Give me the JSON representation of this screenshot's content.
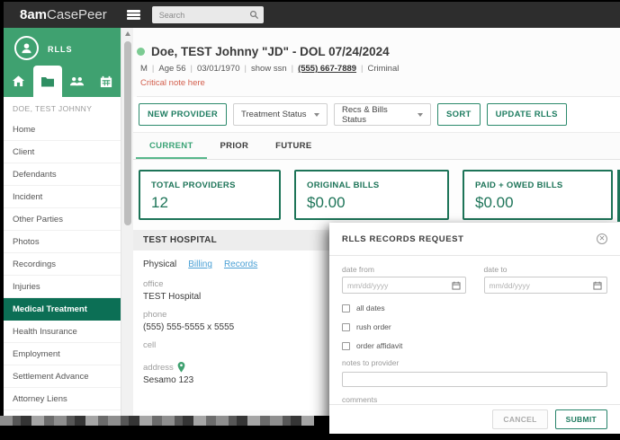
{
  "topbar": {
    "logo_bold": "8am",
    "logo_light": "CasePeer",
    "search_placeholder": "Search"
  },
  "sidebar": {
    "account_label": "RLLS",
    "case_name": "DOE, TEST JOHNNY",
    "items": [
      "Home",
      "Client",
      "Defendants",
      "Incident",
      "Other Parties",
      "Photos",
      "Recordings",
      "Injuries",
      "Medical Treatment",
      "Health Insurance",
      "Employment",
      "Settlement Advance",
      "Attorney Liens"
    ],
    "active_item": "Medical Treatment"
  },
  "header": {
    "title": "Doe, TEST Johnny \"JD\" - DOL 07/24/2024",
    "separator": "|",
    "meta": [
      "M",
      "Age 56",
      "03/01/1970",
      "show ssn",
      "(555) 667-7889",
      "Criminal"
    ],
    "critical_note": "Critical note here"
  },
  "toolbar": {
    "new_provider_label": "NEW PROVIDER",
    "treatment_status_value": "Treatment Status",
    "recs_bills_status_value": "Recs & Bills Status",
    "sort_label": "SORT",
    "update_rlls_label": "UPDATE RLLS"
  },
  "view_tabs": {
    "items": [
      "CURRENT",
      "PRIOR",
      "FUTURE"
    ],
    "active": "CURRENT"
  },
  "summary_cards": [
    {
      "label": "TOTAL PROVIDERS",
      "value": "12"
    },
    {
      "label": "ORIGINAL BILLS",
      "value": "$0.00"
    },
    {
      "label": "PAID + OWED BILLS",
      "value": "$0.00"
    }
  ],
  "provider": {
    "name": "TEST HOSPITAL",
    "tabs": [
      "Physical",
      "Billing",
      "Records"
    ],
    "active_tab": "Physical",
    "fields": {
      "office_label": "office",
      "office_value": "TEST Hospital",
      "phone_label": "phone",
      "phone_value": "(555) 555-5555 x 5555",
      "cell_label": "cell",
      "address_label": "address",
      "address_value": "Sesamo 123"
    }
  },
  "modal": {
    "title": "RLLS RECORDS REQUEST",
    "date_from_label": "date from",
    "date_to_label": "date to",
    "date_placeholder": "mm/dd/yyyy",
    "checkbox_all_dates": "all dates",
    "checkbox_rush_order": "rush order",
    "checkbox_order_affidavit": "order affidavit",
    "notes_label": "notes to provider",
    "comments_label": "comments",
    "cancel_label": "CANCEL",
    "submit_label": "SUBMIT"
  },
  "colors": {
    "brand_green": "#3fa170",
    "active_item_green": "#0c6f55",
    "accent_green": "#1d7458",
    "link_blue": "#4aa0d5",
    "critical_red": "#d35f4d",
    "topbar_dark": "#2d2d2d"
  }
}
